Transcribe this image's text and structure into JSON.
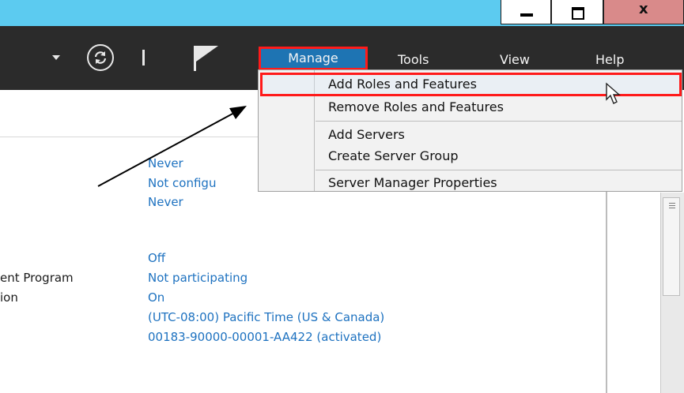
{
  "titlebar": {
    "minimize_icon": "minimize-icon",
    "maximize_icon": "restore-icon",
    "close_glyph": "x"
  },
  "toolbar": {
    "menus": {
      "manage": "Manage",
      "tools": "Tools",
      "view": "View",
      "help": "Help"
    }
  },
  "manage_menu": {
    "items": [
      "Add Roles and Features",
      "Remove Roles and Features",
      "Add Servers",
      "Create Server Group",
      "Server Manager Properties"
    ]
  },
  "properties": {
    "values_top": [
      "Never",
      "Not configu",
      "Never"
    ],
    "labels": [
      "ent Program",
      "ion"
    ],
    "values_bottom": [
      "Off",
      "Not participating",
      "On",
      "(UTC-08:00) Pacific Time (US & Canada)",
      "00183-90000-00001-AA422 (activated)"
    ]
  },
  "colors": {
    "titlebar": "#5ccbf0",
    "toolbar": "#2b2b2b",
    "manage_selected": "#1e74b3",
    "highlight_border": "#ff1a1a",
    "link_value": "#1e72c0"
  }
}
